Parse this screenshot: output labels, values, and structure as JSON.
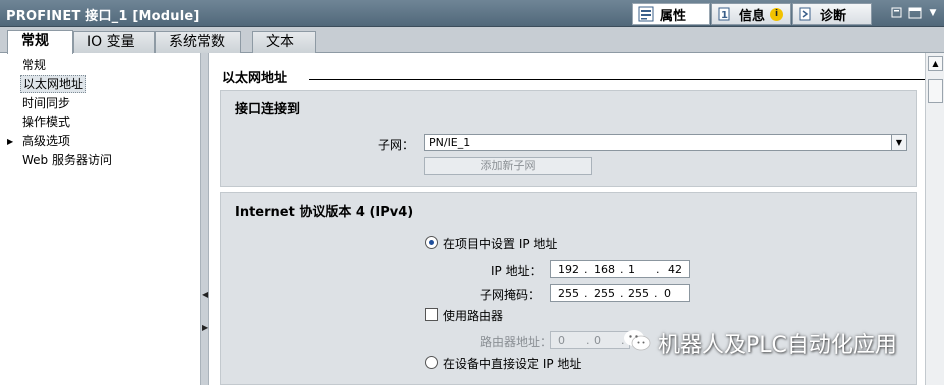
{
  "window": {
    "title": "PROFINET 接口_1 [Module]"
  },
  "top_tabs": [
    {
      "label": "属性",
      "icon": "properties-icon"
    },
    {
      "label": "信息",
      "icon": "info-icon"
    },
    {
      "label": "诊断",
      "icon": "diagnostics-icon"
    }
  ],
  "sub_tabs": [
    "常规",
    "IO 变量",
    "系统常数",
    "文本"
  ],
  "nav": {
    "items": [
      "常规",
      "以太网地址",
      "时间同步",
      "操作模式",
      "高级选项",
      "Web 服务器访问"
    ]
  },
  "main": {
    "section_title": "以太网地址",
    "interface_panel": {
      "title": "接口连接到",
      "subnet_label": "子网：",
      "subnet_value": "PN/IE_1",
      "add_subnet_button": "添加新子网"
    },
    "ipv4_panel": {
      "title": "Internet 协议版本 4 (IPv4)",
      "radio_project": "在项目中设置 IP 地址",
      "ip_label": "IP 地址：",
      "ip_octets": [
        "192",
        "168",
        "1",
        "42"
      ],
      "mask_label": "子网掩码：",
      "mask_octets": [
        "255",
        "255",
        "255",
        "0"
      ],
      "use_router_label": "使用路由器",
      "router_label": "路由器地址：",
      "router_octets": [
        "0",
        "0"
      ],
      "radio_device": "在设备中直接设定 IP 地址"
    }
  },
  "watermark": {
    "text": "机器人及PLC自动化应用"
  },
  "colors": {
    "titlebar": "#5e7486",
    "panel": "#dde1e5",
    "radio_accent": "#1f4e9a"
  }
}
